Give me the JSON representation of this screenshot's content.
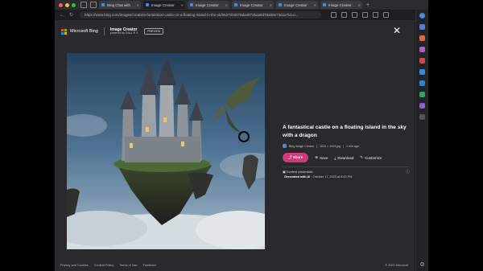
{
  "browser": {
    "tabs": [
      {
        "label": "Bing Chat with",
        "active": false
      },
      {
        "label": "Image Creator",
        "active": true
      },
      {
        "label": "Image Creator",
        "active": false
      },
      {
        "label": "Image Creator",
        "active": false
      },
      {
        "label": "Image Creator",
        "active": false
      },
      {
        "label": "Image Creator",
        "active": false
      },
      {
        "label": "Image Creator",
        "active": false
      }
    ],
    "new_tab": "+",
    "url": "https://www.bing.com/images/create/a-fantastical-castle-on-a-floating-island-in-the-sk/6527202076da4972baa6d78a69e73a1a?id=n..."
  },
  "header": {
    "brand": "Microsoft Bing",
    "product": "Image Creator",
    "powered_by": "powered by DALL·E 3",
    "badge": "PREVIEW"
  },
  "detail": {
    "title": "A fantastical castle on a floating island in the sky with a dragon",
    "source": "Bing Image Creator",
    "resolution": "1024 × 1024 jpg",
    "age": "1 min ago",
    "actions": {
      "share": "Share",
      "save": "Save",
      "download": "Download",
      "customize": "Customize"
    },
    "credentials_heading": "Content credentials",
    "generated_label": "Generated with AI",
    "generated_date": "· October 17, 2023 at 8:00 PM"
  },
  "footer": {
    "links": [
      "Privacy and Cookies",
      "Content Policy",
      "Terms of Use",
      "Feedback"
    ],
    "copyright": "© 2023 Microsoft"
  },
  "colors": {
    "share_button": "#d93779",
    "accent": "#3b8eea"
  }
}
